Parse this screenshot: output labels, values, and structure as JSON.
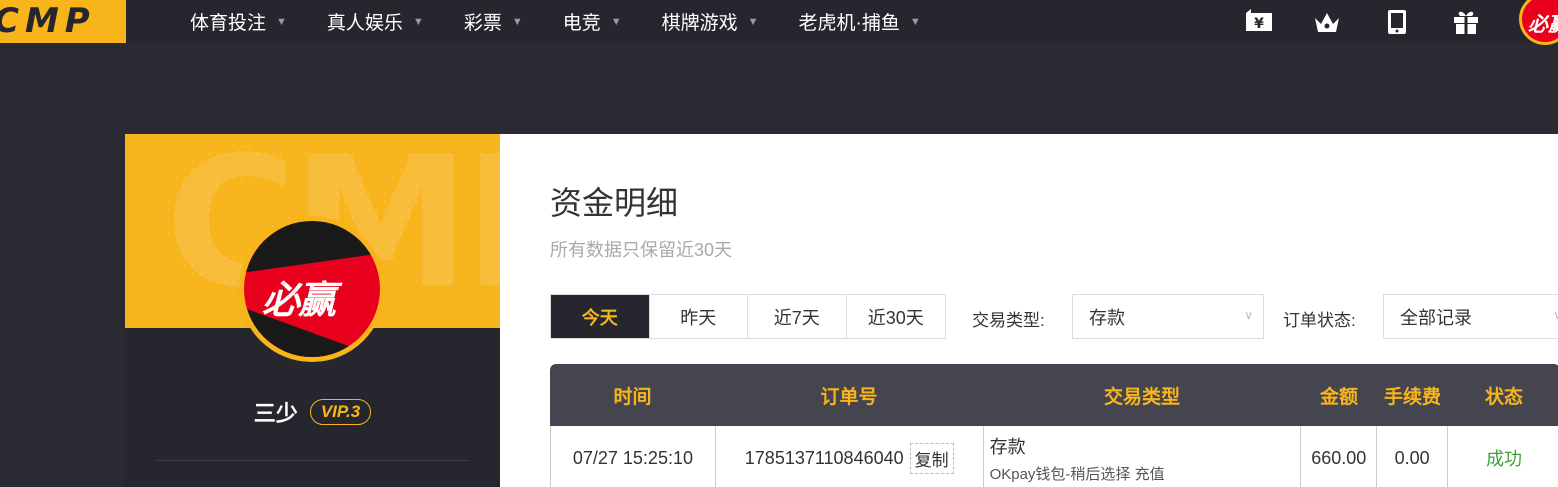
{
  "brand": {
    "logo_text": "CMP",
    "avatar_text": "必赢"
  },
  "nav": {
    "items": [
      {
        "label": "体育投注"
      },
      {
        "label": "真人娱乐"
      },
      {
        "label": "彩票"
      },
      {
        "label": "电竞"
      },
      {
        "label": "棋牌游戏"
      },
      {
        "label": "老虎机·捕鱼"
      }
    ],
    "icons": [
      "wallet-icon",
      "crown-icon",
      "tablet-icon",
      "gift-icon"
    ]
  },
  "profile": {
    "watermark": "CMP",
    "username": "三少",
    "vip": "VIP.3"
  },
  "main": {
    "title": "资金明细",
    "subtitle": "所有数据只保留近30天",
    "ranges": [
      "今天",
      "昨天",
      "近7天",
      "近30天"
    ],
    "type_label": "交易类型:",
    "type_value": "存款",
    "status_label": "订单状态:",
    "status_value": "全部记录"
  },
  "table": {
    "headers": [
      "时间",
      "订单号",
      "交易类型",
      "金额",
      "手续费",
      "状态"
    ],
    "rows": [
      {
        "time": "07/27 15:25:10",
        "order": "178513711084604​0",
        "copy": "复制",
        "type": "存款",
        "type_detail": "OKpay钱包-稍后选择 充值",
        "amount": "660.00",
        "fee": "0.00",
        "status": "成功"
      }
    ]
  },
  "colors": {
    "accent": "#f7b41b",
    "dark": "#26262e",
    "success": "#3aa335"
  }
}
